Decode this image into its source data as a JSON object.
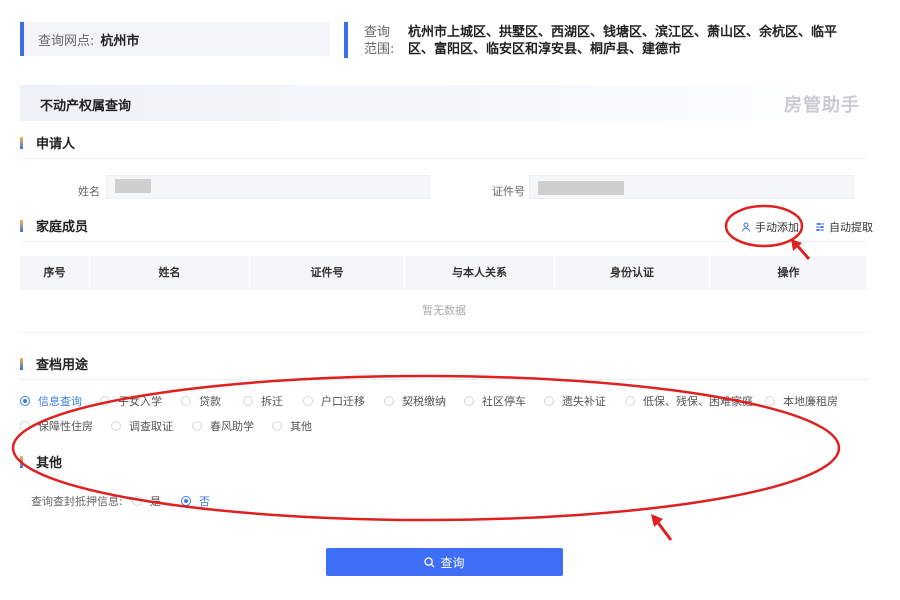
{
  "top": {
    "outlet_label": "查询网点:",
    "outlet_value": "杭州市",
    "range_label_1": "查询",
    "range_label_2": "范围:",
    "range_text": "杭州市上城区、拱墅区、西湖区、钱塘区、滨江区、萧山区、余杭区、临平区、富阳区、临安区和淳安县、桐庐县、建德市"
  },
  "banner": {
    "title": "不动产权属查询",
    "brand": "房管助手"
  },
  "applicant": {
    "section_title": "申请人",
    "name_label": "姓名",
    "id_label": "证件号"
  },
  "family": {
    "section_title": "家庭成员",
    "manual_add": "手动添加",
    "auto_fetch": "自动提取",
    "columns": [
      "序号",
      "姓名",
      "证件号",
      "与本人关系",
      "身份认证",
      "操作"
    ],
    "empty_text": "暂无数据"
  },
  "purpose": {
    "section_title": "查档用途",
    "options": [
      "信息查询",
      "子女入学",
      "贷款",
      "拆迁",
      "户口迁移",
      "契税缴纳",
      "社区停车",
      "遗失补证",
      "低保、残保、困难家庭",
      "本地廉租房",
      "保障性住房",
      "调查取证",
      "春风助学",
      "其他"
    ],
    "selected": "信息查询"
  },
  "other": {
    "section_title": "其他",
    "mortgage_label": "查询查封抵押信息:",
    "yes_label": "是",
    "no_label": "否",
    "selected": "否"
  },
  "actions": {
    "query_label": "查询"
  },
  "colors": {
    "accent": "#3d6ef5",
    "annotation": "#e02020"
  }
}
